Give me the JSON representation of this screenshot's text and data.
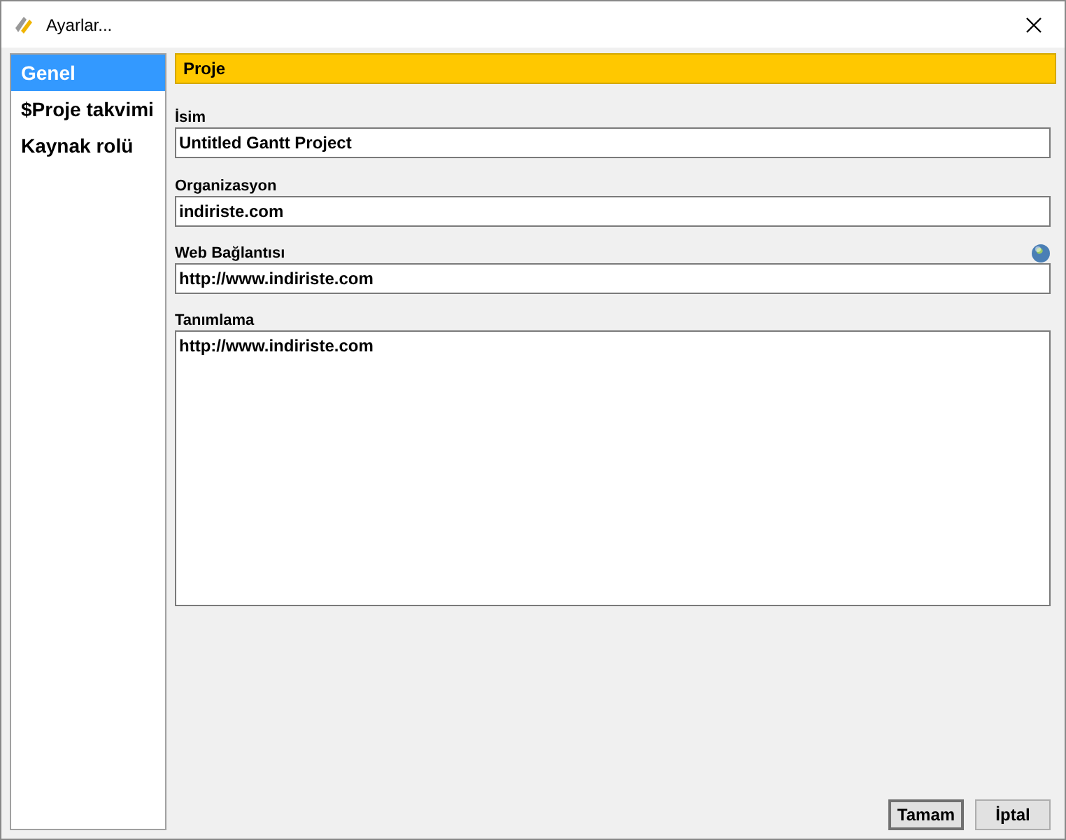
{
  "window": {
    "title": "Ayarlar..."
  },
  "sidebar": {
    "items": [
      {
        "label": "Genel",
        "selected": true
      },
      {
        "label": "$Proje takvimi",
        "selected": false
      },
      {
        "label": "Kaynak rolü",
        "selected": false
      }
    ]
  },
  "section": {
    "title": "Proje"
  },
  "fields": [
    {
      "kind": "text",
      "label": "İsim",
      "value": "Untitled Gantt Project"
    },
    {
      "kind": "text",
      "label": "Organizasyon",
      "value": "indiriste.com"
    },
    {
      "kind": "link",
      "label": "Web Bağlantısı",
      "value": "http://www.indiriste.com"
    },
    {
      "kind": "textarea",
      "label": "Tanımlama",
      "value": "http://www.indiriste.com"
    }
  ],
  "buttons": [
    {
      "label": "Tamam",
      "default": true
    },
    {
      "label": "İptal",
      "default": false
    }
  ]
}
